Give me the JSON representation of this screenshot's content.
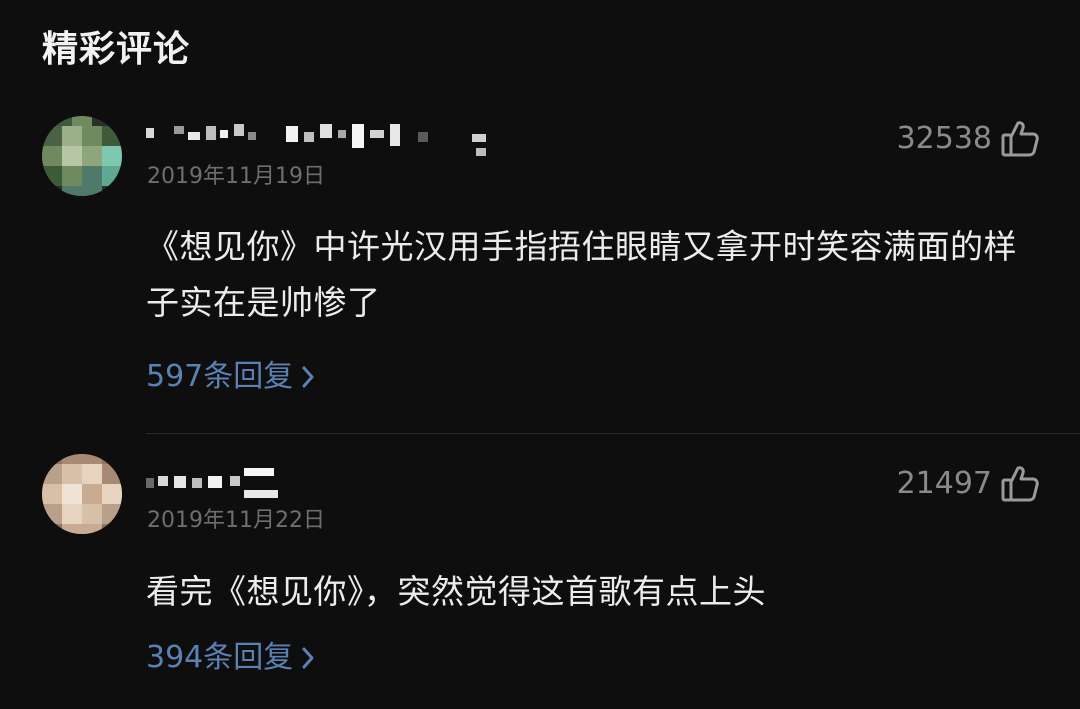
{
  "section": {
    "title": "精彩评论"
  },
  "comments": [
    {
      "username_masked": true,
      "date": "2019年11月19日",
      "likes": "32538",
      "text": "《想见你》中许光汉用手指捂住眼睛又拿开时笑容满面的样子实在是帅惨了",
      "replies": "597条回复",
      "avatar_palette": [
        "#3d5a3a",
        "#6f8a5e",
        "#9bb08a",
        "#4f7a6a",
        "#7fc7b0",
        "#2f3b2c"
      ]
    },
    {
      "username_masked": true,
      "date": "2019年11月22日",
      "likes": "21497",
      "text": "看完《想见你》，突然觉得这首歌有点上头",
      "replies": "394条回复",
      "avatar_palette": [
        "#b9a08a",
        "#d8c0a8",
        "#8e7562",
        "#e6d3c0",
        "#a88a74",
        "#6e5a4c"
      ]
    }
  ],
  "icons": {
    "like": "thumbs-up-icon",
    "chevron": "chevron-right-icon"
  },
  "colors": {
    "background": "#0e0e0e",
    "link": "#5b80b3",
    "muted": "#6e6e6e"
  }
}
